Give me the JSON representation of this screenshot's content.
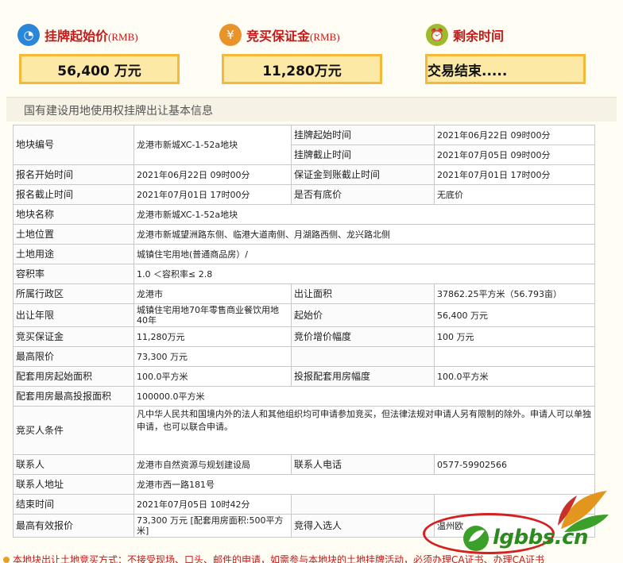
{
  "summary": {
    "start_price": {
      "label": "挂牌起始价",
      "unit": "(RMB)",
      "value": "56,400  万元",
      "icon": "stopwatch-icon",
      "color": "#2a86d8"
    },
    "deposit": {
      "label": "竞买保证金",
      "unit": "(RMB)",
      "value": "11,280万元",
      "icon": "money-bag-icon",
      "color": "#e8942a"
    },
    "remaining": {
      "label": "剩余时间",
      "value": "交易结束.....",
      "icon": "alarm-clock-icon",
      "color": "#9dbb2a"
    }
  },
  "section_title": "国有建设用地使用权挂牌出让基本信息",
  "table": {
    "parcel_no": {
      "k": "地块编号",
      "v": "龙港市新城XC-1-52a地块"
    },
    "list_start": {
      "k": "挂牌起始时间",
      "v": "2021年06月22日  09时00分"
    },
    "list_end": {
      "k": "挂牌截止时间",
      "v": "2021年07月05日  09时00分"
    },
    "reg_start": {
      "k": "报名开始时间",
      "v": "2021年06月22日  09时00分"
    },
    "deposit_due": {
      "k": "保证金到账截止时间",
      "v": "2021年07月01日  17时00分"
    },
    "reg_end": {
      "k": "报名截止时间",
      "v": "2021年07月01日  17时00分"
    },
    "reserve": {
      "k": "是否有底价",
      "v": "无底价"
    },
    "name": {
      "k": "地块名称",
      "v": "龙港市新城XC-1-52a地块"
    },
    "location": {
      "k": "土地位置",
      "v": "龙港市新城望洲路东侧、临港大道南侧、月湖路西侧、龙兴路北侧"
    },
    "use": {
      "k": "土地用途",
      "v": "城镇住宅用地(普通商品房）/"
    },
    "far": {
      "k": "容积率",
      "v": "1.0 ＜容积率≤ 2.8"
    },
    "district": {
      "k": "所属行政区",
      "v": "龙港市"
    },
    "area": {
      "k": "出让面积",
      "v": "37862.25平方米（56.793亩）"
    },
    "term": {
      "k": "出让年限",
      "v": "城镇住宅用地70年零售商业餐饮用地40年"
    },
    "start_price": {
      "k": "起始价",
      "v": "56,400  万元"
    },
    "deposit": {
      "k": "竞买保证金",
      "v": "11,280万元"
    },
    "increment": {
      "k": "竞价增价幅度",
      "v": "100  万元"
    },
    "max_price": {
      "k": "最高限价",
      "v": "73,300  万元"
    },
    "house_start": {
      "k": "配套用房起始面积",
      "v": "100.0平方米"
    },
    "house_step": {
      "k": "投报配套用房幅度",
      "v": "100.0平方米"
    },
    "house_max": {
      "k": "配套用房最高投报面积",
      "v": "100000.0平方米"
    },
    "conditions": {
      "k": "竞买人条件",
      "v": "凡中华人民共和国境内外的法人和其他组织均可申请参加竞买，但法律法规对申请人另有限制的除外。申请人可以单独申请，也可以联合申请。"
    },
    "contact": {
      "k": "联系人",
      "v": "龙港市自然资源与规划建设局"
    },
    "phone": {
      "k": "联系人电话",
      "v": "0577-59902566"
    },
    "address": {
      "k": "联系人地址",
      "v": "龙港市西一路181号"
    },
    "end_time": {
      "k": "结束时间",
      "v": "2021年07月05日  10时42分"
    },
    "top_bid": {
      "k": "最高有效报价",
      "v": "73,300  万元 [配套用房面积:500平方米]"
    },
    "winner": {
      "k": "竞得入选人",
      "v": "温州欧"
    }
  },
  "bottom_note": "本地块出让土地竞买方式：不接受现场、口头、邮件的申请，如需参与本地块的土地挂牌活动，必须办理CA证书、办理CA证书",
  "watermark": {
    "text": "lgbbs.cn"
  }
}
